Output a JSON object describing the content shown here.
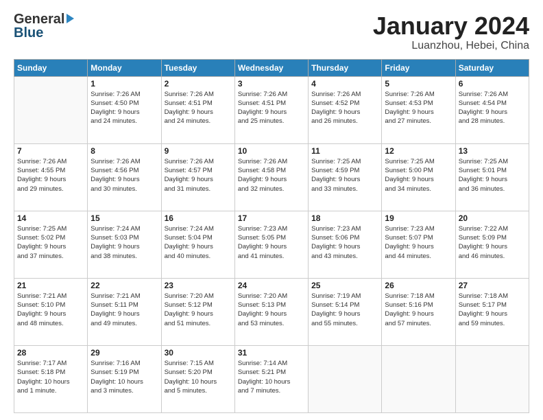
{
  "logo": {
    "line1": "General",
    "line2": "Blue"
  },
  "title": {
    "month_year": "January 2024",
    "location": "Luanzhou, Hebei, China"
  },
  "headers": [
    "Sunday",
    "Monday",
    "Tuesday",
    "Wednesday",
    "Thursday",
    "Friday",
    "Saturday"
  ],
  "weeks": [
    [
      {
        "day": "",
        "info": ""
      },
      {
        "day": "1",
        "info": "Sunrise: 7:26 AM\nSunset: 4:50 PM\nDaylight: 9 hours\nand 24 minutes."
      },
      {
        "day": "2",
        "info": "Sunrise: 7:26 AM\nSunset: 4:51 PM\nDaylight: 9 hours\nand 24 minutes."
      },
      {
        "day": "3",
        "info": "Sunrise: 7:26 AM\nSunset: 4:51 PM\nDaylight: 9 hours\nand 25 minutes."
      },
      {
        "day": "4",
        "info": "Sunrise: 7:26 AM\nSunset: 4:52 PM\nDaylight: 9 hours\nand 26 minutes."
      },
      {
        "day": "5",
        "info": "Sunrise: 7:26 AM\nSunset: 4:53 PM\nDaylight: 9 hours\nand 27 minutes."
      },
      {
        "day": "6",
        "info": "Sunrise: 7:26 AM\nSunset: 4:54 PM\nDaylight: 9 hours\nand 28 minutes."
      }
    ],
    [
      {
        "day": "7",
        "info": "Sunrise: 7:26 AM\nSunset: 4:55 PM\nDaylight: 9 hours\nand 29 minutes."
      },
      {
        "day": "8",
        "info": "Sunrise: 7:26 AM\nSunset: 4:56 PM\nDaylight: 9 hours\nand 30 minutes."
      },
      {
        "day": "9",
        "info": "Sunrise: 7:26 AM\nSunset: 4:57 PM\nDaylight: 9 hours\nand 31 minutes."
      },
      {
        "day": "10",
        "info": "Sunrise: 7:26 AM\nSunset: 4:58 PM\nDaylight: 9 hours\nand 32 minutes."
      },
      {
        "day": "11",
        "info": "Sunrise: 7:25 AM\nSunset: 4:59 PM\nDaylight: 9 hours\nand 33 minutes."
      },
      {
        "day": "12",
        "info": "Sunrise: 7:25 AM\nSunset: 5:00 PM\nDaylight: 9 hours\nand 34 minutes."
      },
      {
        "day": "13",
        "info": "Sunrise: 7:25 AM\nSunset: 5:01 PM\nDaylight: 9 hours\nand 36 minutes."
      }
    ],
    [
      {
        "day": "14",
        "info": "Sunrise: 7:25 AM\nSunset: 5:02 PM\nDaylight: 9 hours\nand 37 minutes."
      },
      {
        "day": "15",
        "info": "Sunrise: 7:24 AM\nSunset: 5:03 PM\nDaylight: 9 hours\nand 38 minutes."
      },
      {
        "day": "16",
        "info": "Sunrise: 7:24 AM\nSunset: 5:04 PM\nDaylight: 9 hours\nand 40 minutes."
      },
      {
        "day": "17",
        "info": "Sunrise: 7:23 AM\nSunset: 5:05 PM\nDaylight: 9 hours\nand 41 minutes."
      },
      {
        "day": "18",
        "info": "Sunrise: 7:23 AM\nSunset: 5:06 PM\nDaylight: 9 hours\nand 43 minutes."
      },
      {
        "day": "19",
        "info": "Sunrise: 7:23 AM\nSunset: 5:07 PM\nDaylight: 9 hours\nand 44 minutes."
      },
      {
        "day": "20",
        "info": "Sunrise: 7:22 AM\nSunset: 5:09 PM\nDaylight: 9 hours\nand 46 minutes."
      }
    ],
    [
      {
        "day": "21",
        "info": "Sunrise: 7:21 AM\nSunset: 5:10 PM\nDaylight: 9 hours\nand 48 minutes."
      },
      {
        "day": "22",
        "info": "Sunrise: 7:21 AM\nSunset: 5:11 PM\nDaylight: 9 hours\nand 49 minutes."
      },
      {
        "day": "23",
        "info": "Sunrise: 7:20 AM\nSunset: 5:12 PM\nDaylight: 9 hours\nand 51 minutes."
      },
      {
        "day": "24",
        "info": "Sunrise: 7:20 AM\nSunset: 5:13 PM\nDaylight: 9 hours\nand 53 minutes."
      },
      {
        "day": "25",
        "info": "Sunrise: 7:19 AM\nSunset: 5:14 PM\nDaylight: 9 hours\nand 55 minutes."
      },
      {
        "day": "26",
        "info": "Sunrise: 7:18 AM\nSunset: 5:16 PM\nDaylight: 9 hours\nand 57 minutes."
      },
      {
        "day": "27",
        "info": "Sunrise: 7:18 AM\nSunset: 5:17 PM\nDaylight: 9 hours\nand 59 minutes."
      }
    ],
    [
      {
        "day": "28",
        "info": "Sunrise: 7:17 AM\nSunset: 5:18 PM\nDaylight: 10 hours\nand 1 minute."
      },
      {
        "day": "29",
        "info": "Sunrise: 7:16 AM\nSunset: 5:19 PM\nDaylight: 10 hours\nand 3 minutes."
      },
      {
        "day": "30",
        "info": "Sunrise: 7:15 AM\nSunset: 5:20 PM\nDaylight: 10 hours\nand 5 minutes."
      },
      {
        "day": "31",
        "info": "Sunrise: 7:14 AM\nSunset: 5:21 PM\nDaylight: 10 hours\nand 7 minutes."
      },
      {
        "day": "",
        "info": ""
      },
      {
        "day": "",
        "info": ""
      },
      {
        "day": "",
        "info": ""
      }
    ]
  ]
}
